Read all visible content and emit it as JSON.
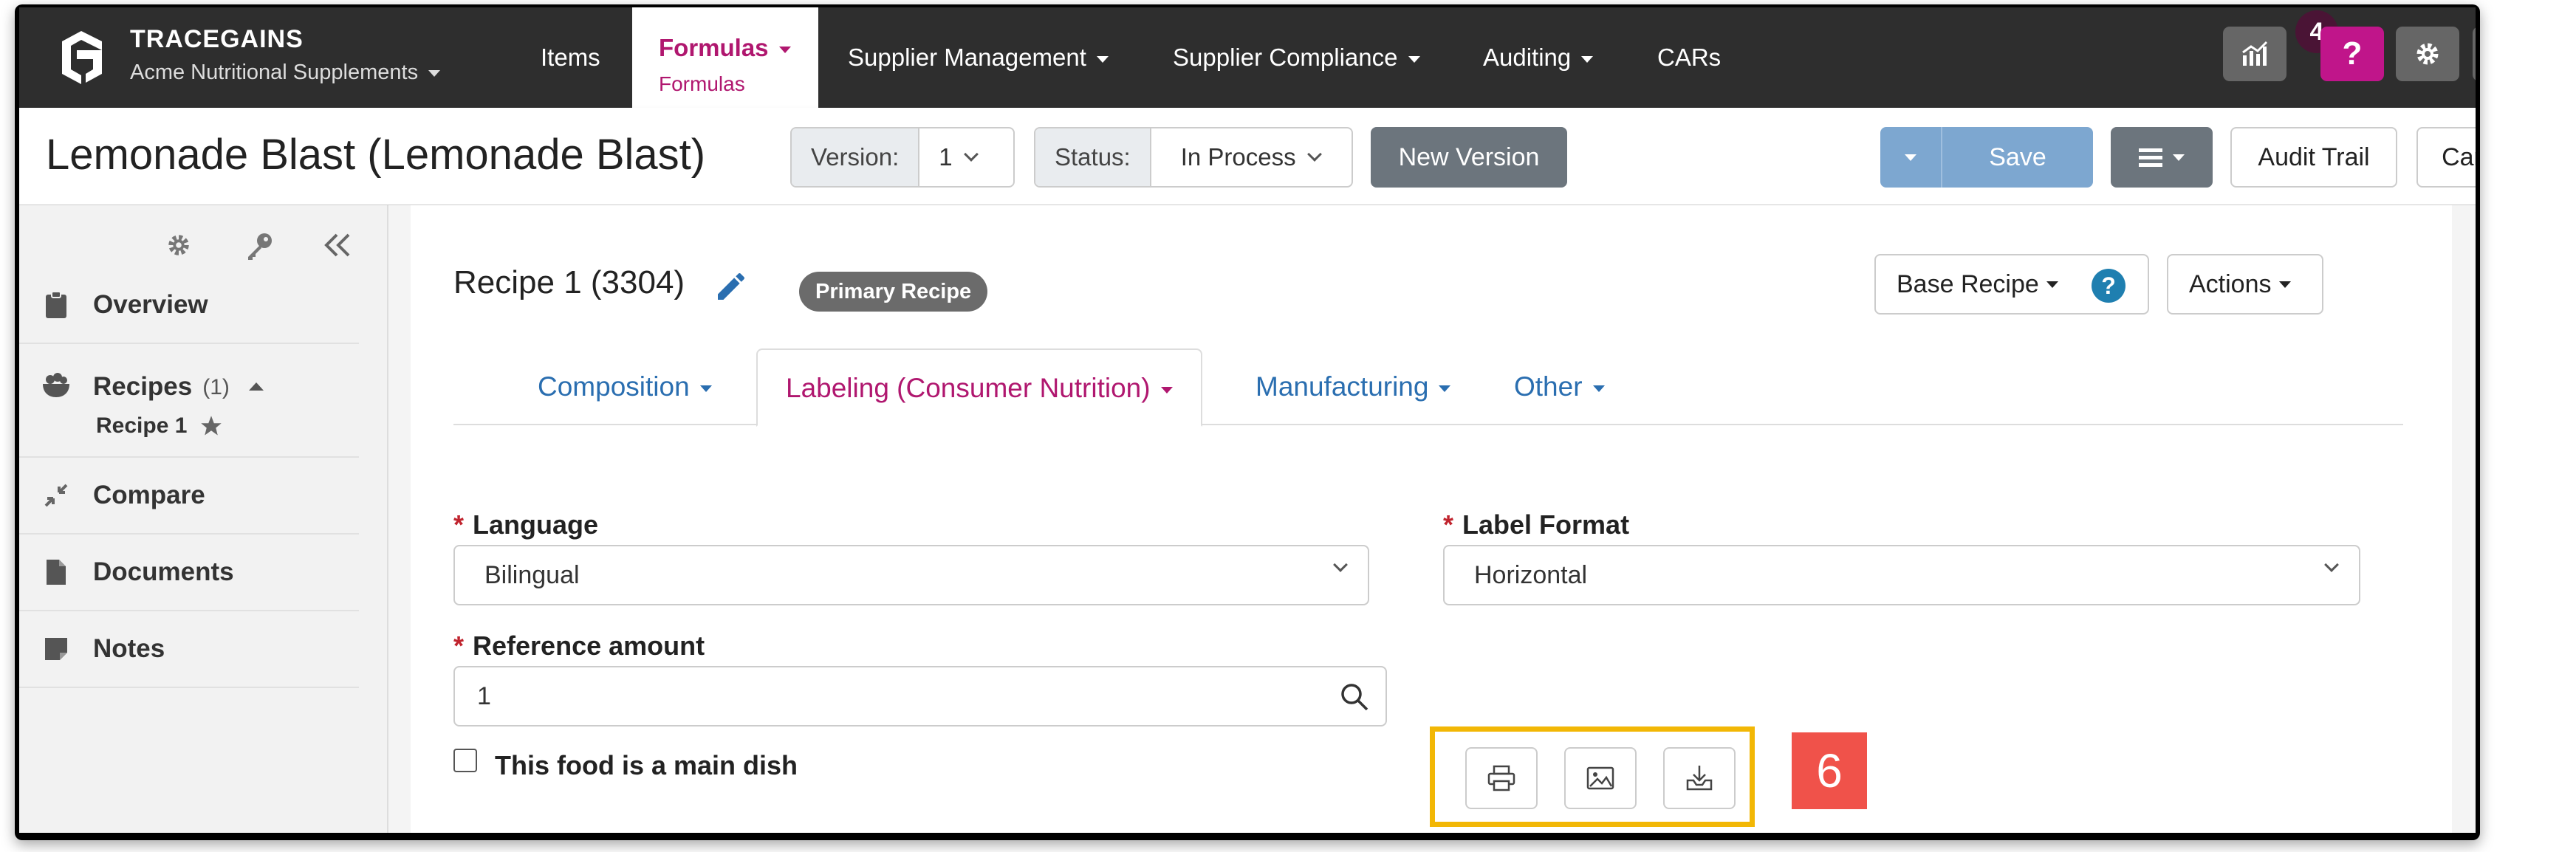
{
  "nav": {
    "brand": "TRACEGAINS",
    "org": "Acme Nutritional Supplements",
    "items": [
      "Items",
      "Supplier Management",
      "Supplier Compliance",
      "Auditing",
      "CARs"
    ],
    "active": {
      "label": "Formulas",
      "sub": "Formulas"
    },
    "notification_count": "4",
    "help_label": "?"
  },
  "header": {
    "title": "Lemonade Blast (Lemonade Blast)",
    "version_label": "Version:",
    "version_value": "1",
    "status_label": "Status:",
    "status_value": "In Process",
    "new_version": "New Version",
    "save": "Save",
    "audit_trail": "Audit Trail",
    "cancel": "Cancel"
  },
  "sidebar": {
    "items": [
      {
        "label": "Overview"
      },
      {
        "label": "Recipes",
        "count": "(1)",
        "sub": "Recipe 1"
      },
      {
        "label": "Compare"
      },
      {
        "label": "Documents"
      },
      {
        "label": "Notes"
      }
    ]
  },
  "recipe": {
    "title": "Recipe 1 (3304)",
    "badge": "Primary Recipe",
    "base_recipe": "Base Recipe",
    "help": "?",
    "actions": "Actions"
  },
  "tabs": [
    "Composition",
    "Labeling (Consumer Nutrition)",
    "Manufacturing",
    "Other"
  ],
  "form": {
    "required_mark": "*",
    "language_label": "Language",
    "language_value": "Bilingual",
    "label_format_label": "Label Format",
    "label_format_value": "Horizontal",
    "reference_label": "Reference amount",
    "reference_value": "1",
    "main_dish_label": "This food is a main dish"
  },
  "annotation_number": "6",
  "colors": {
    "nav_bg": "#2e2e2e",
    "brand_magenta": "#b0176f",
    "link_blue": "#2a6eb0",
    "save_blue": "#7da7d0",
    "highlight": "#f2b705",
    "marker_red": "#f0524a"
  }
}
